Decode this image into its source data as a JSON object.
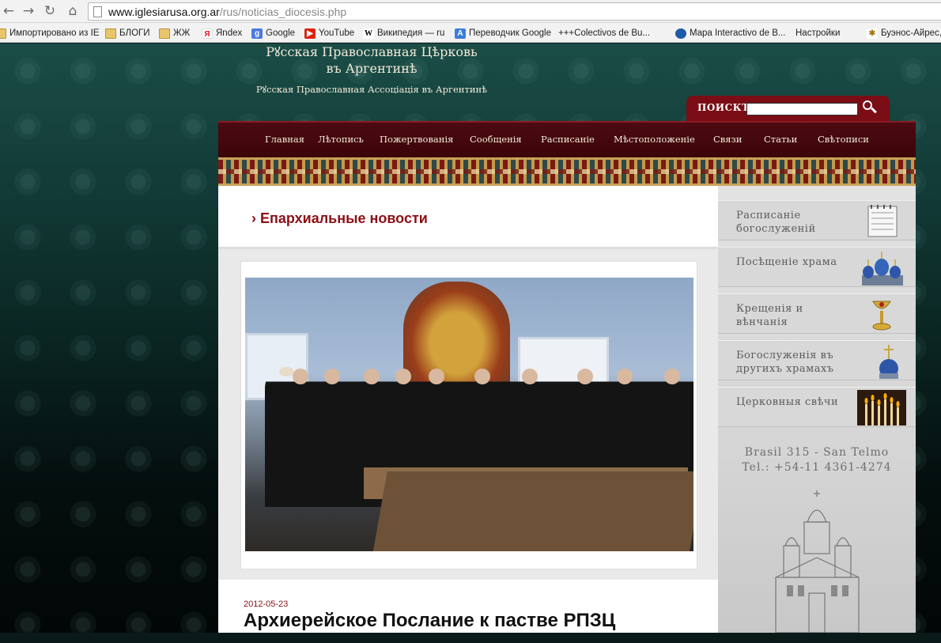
{
  "browser": {
    "url_host": "www.iglesiarusa.org.ar",
    "url_path": "/rus/noticias_diocesis.php",
    "bookmarks": [
      {
        "label": "Импортировано из IE",
        "icon": "folder-icon"
      },
      {
        "label": "БЛОГИ",
        "icon": "folder-icon"
      },
      {
        "label": "ЖЖ",
        "icon": "folder-icon"
      },
      {
        "label": "Яndex",
        "icon": "yandex-icon"
      },
      {
        "label": "Google",
        "icon": "google-icon"
      },
      {
        "label": "YouTube",
        "icon": "youtube-icon"
      },
      {
        "label": "Википедия — ru",
        "icon": "wikipedia-icon"
      },
      {
        "label": "Переводчик Google",
        "icon": "translate-icon"
      },
      {
        "label": "+++Colectivos de Bu...",
        "icon": "page-icon"
      },
      {
        "label": "Mapa Interactivo de B...",
        "icon": "map-icon"
      },
      {
        "label": "Настройки",
        "icon": "page-icon"
      },
      {
        "label": "Буэнос-Айрес, Т",
        "icon": "gear-icon"
      }
    ]
  },
  "site": {
    "title_line1": "Рꙋсская Православная Цѣрковь",
    "title_line2": "въ Аргентинѣ",
    "subtitle": "Рꙋсская Православная Ассоціація въ Аргентинѣ",
    "search_label": "ПОИСКЪ",
    "search_value": ""
  },
  "menu": [
    "Главная",
    "Лѣтопись",
    "Пожертвованія",
    "Сообщенія",
    "Расписаніе",
    "Мѣстоположеніе",
    "Связи",
    "Статьи",
    "Свѣтописи"
  ],
  "content": {
    "headline": "› Епархиальные новости",
    "post_date": "2012-05-23",
    "post_title": "Архиерейское Послание к пастве РПЗЦ"
  },
  "sidebar": {
    "items": [
      {
        "label": "Расписаніе богослуженій",
        "icon": "calendar-icon"
      },
      {
        "label": "Посѣщеніе храма",
        "icon": "church-domes-icon"
      },
      {
        "label": "Крещенія и вѣнчанія",
        "icon": "chalice-icon"
      },
      {
        "label": "Богослуженія въ другихъ храмахъ",
        "icon": "cross-dome-icon"
      },
      {
        "label": "Церковныя свѣчи",
        "icon": "candles-icon"
      }
    ],
    "address_line1": "Brasil 315 - San Telmo",
    "address_line2": "Tel.: +54-11 4361-4274"
  }
}
